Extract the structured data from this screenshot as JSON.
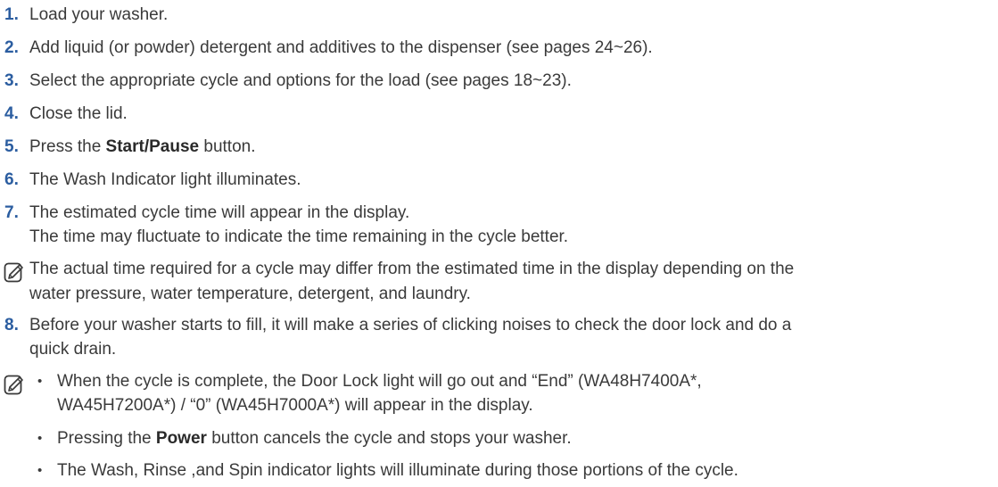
{
  "steps": [
    {
      "num": "1.",
      "text": "Load your washer."
    },
    {
      "num": "2.",
      "text": "Add liquid (or powder) detergent and additives to the dispenser (see pages 24~26)."
    },
    {
      "num": "3.",
      "text": "Select the appropriate cycle and options for the load (see pages 18~23)."
    },
    {
      "num": "4.",
      "text": "Close the lid."
    },
    {
      "num": "5.",
      "pre": "Press the ",
      "bold": "Start/Pause",
      "post": " button."
    },
    {
      "num": "6.",
      "text": "The Wash Indicator light illuminates."
    },
    {
      "num": "7.",
      "text": "The estimated cycle time will appear in the display.",
      "line2": "The time may fluctuate to indicate the time remaining in the cycle better."
    },
    {
      "num": "8.",
      "text": "Before your washer starts to fill, it will make a series of clicking noises to check the door lock and do a",
      "line2": "quick drain."
    }
  ],
  "note1": {
    "icon": "note-pencil-icon",
    "line1": "The actual time required for a cycle may differ from the estimated time in the display depending on the",
    "line2": "water pressure, water temperature, detergent, and laundry."
  },
  "note2": {
    "icon": "note-pencil-icon",
    "bullet_char": "•",
    "b1_line1": "When the cycle is complete, the Door Lock light will go out and “End” (WA48H7400A*,",
    "b1_line2": "WA45H7200A*) / “0” (WA45H7000A*) will appear in the display.",
    "b2_pre": "Pressing the ",
    "b2_bold": "Power",
    "b2_post": " button cancels the cycle and stops your washer.",
    "b3": "The Wash, Rinse ,and Spin indicator lights will illuminate during those portions of the cycle."
  },
  "colors": {
    "number": "#2b5da0",
    "text": "#3a3a3a"
  }
}
